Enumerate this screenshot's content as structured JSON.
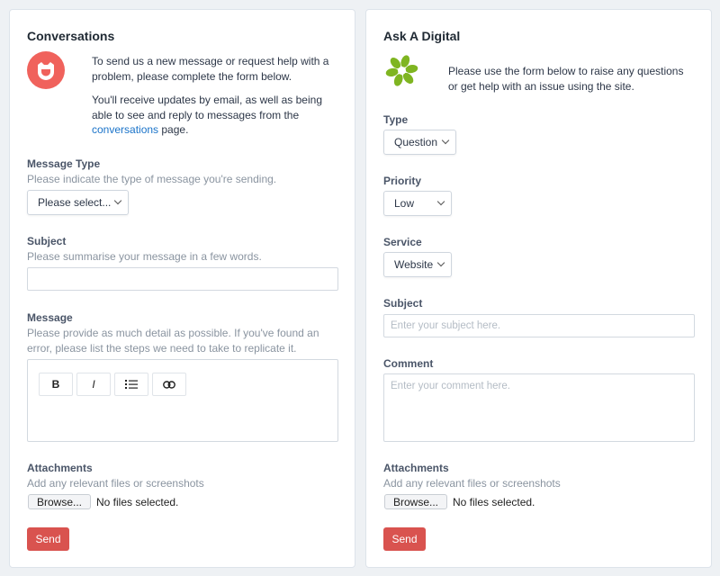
{
  "conversations": {
    "title": "Conversations",
    "intro_1": "To send us a new message or request help with a problem, please complete the form below.",
    "intro_2_before": "You'll receive updates by email, as well as being able to see and reply to messages from the ",
    "intro_2_link": "conversations",
    "intro_2_after": " page.",
    "message_type": {
      "label": "Message Type",
      "help": "Please indicate the type of message you're sending.",
      "selected": "Please select..."
    },
    "subject": {
      "label": "Subject",
      "help": "Please summarise your message in a few words.",
      "value": ""
    },
    "message": {
      "label": "Message",
      "help": "Please provide as much detail as possible. If you've found an error, please list the steps we need to take to replicate it.",
      "toolbar": {
        "bold": "B",
        "italic": "I"
      }
    },
    "attachments": {
      "label": "Attachments",
      "help": "Add any relevant files or screenshots",
      "browse": "Browse...",
      "status": "No files selected."
    },
    "send": "Send"
  },
  "ask": {
    "title": "Ask A Digital",
    "intro": "Please use the form below to raise any questions or get help with an issue using the site.",
    "type": {
      "label": "Type",
      "selected": "Question"
    },
    "priority": {
      "label": "Priority",
      "selected": "Low"
    },
    "service": {
      "label": "Service",
      "selected": "Website"
    },
    "subject": {
      "label": "Subject",
      "placeholder": "Enter your subject here."
    },
    "comment": {
      "label": "Comment",
      "placeholder": "Enter your comment here."
    },
    "attachments": {
      "label": "Attachments",
      "help": "Add any relevant files or screenshots",
      "browse": "Browse...",
      "status": "No files selected."
    },
    "send": "Send"
  },
  "colors": {
    "logo_red": "#f0625c",
    "logo_green": "#7fb521",
    "send_button": "#d9534f",
    "link": "#1a73c9"
  }
}
